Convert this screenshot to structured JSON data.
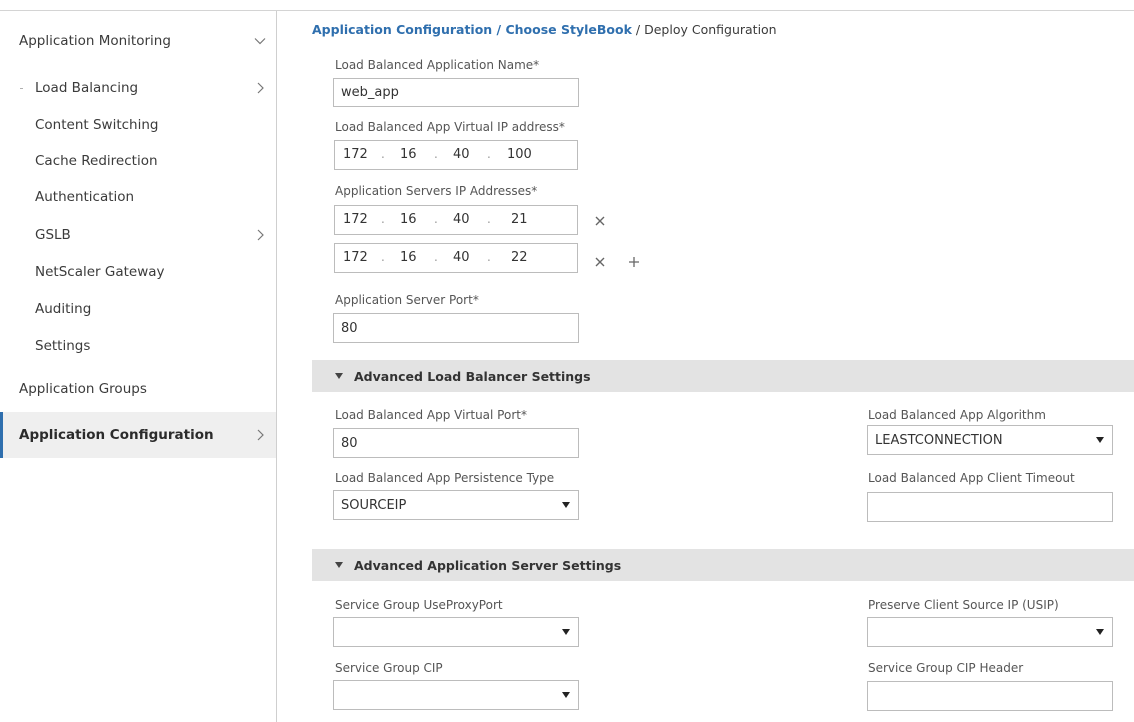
{
  "breadcrumb": {
    "crumb1": "Application Configuration",
    "sep1": " / ",
    "crumb2": "Choose StyleBook",
    "sep2": " / ",
    "current": "Deploy Configuration"
  },
  "sidebar": {
    "application_monitoring": "Application Monitoring",
    "load_balancing": "Load Balancing",
    "content_switching": "Content Switching",
    "cache_redirection": "Cache Redirection",
    "authentication": "Authentication",
    "gslb": "GSLB",
    "netscaler_gateway": "NetScaler Gateway",
    "auditing": "Auditing",
    "settings": "Settings",
    "application_groups": "Application Groups",
    "application_configuration": "Application Configuration"
  },
  "form": {
    "app_name_label": "Load Balanced Application Name*",
    "app_name_value": "web_app",
    "vip_label": "Load Balanced App Virtual IP address*",
    "vip": [
      "172",
      "16",
      "40",
      "100"
    ],
    "servers_label": "Application Servers IP Addresses*",
    "server1": [
      "172",
      "16",
      "40",
      "21"
    ],
    "server2": [
      "172",
      "16",
      "40",
      "22"
    ],
    "port_label": "Application Server Port*",
    "port_value": "80"
  },
  "advanced_lb": {
    "title": "Advanced Load Balancer Settings",
    "vport_label": "Load Balanced App Virtual Port*",
    "vport_value": "80",
    "algorithm_label": "Load Balanced App Algorithm",
    "algorithm_value": "LEASTCONNECTION",
    "persistence_label": "Load Balanced App Persistence Type",
    "persistence_value": "SOURCEIP",
    "timeout_label": "Load Balanced App Client Timeout",
    "timeout_value": ""
  },
  "advanced_server": {
    "title": "Advanced Application Server Settings",
    "useproxyport_label": "Service Group UseProxyPort",
    "useproxyport_value": "",
    "usip_label": "Preserve Client Source IP (USIP)",
    "usip_value": "",
    "cip_label": "Service Group CIP",
    "cip_value": "",
    "cip_header_label": "Service Group CIP Header",
    "cip_header_value": ""
  },
  "icons": {
    "chevron": "chevron-icon",
    "remove": "close-icon",
    "add": "plus-icon",
    "section_toggle": "triangle-down-icon",
    "dropdown": "dropdown-arrow-icon"
  },
  "colors": {
    "link": "#2f6fae",
    "section_bg": "#e3e3e3",
    "active_nav_bg": "#efefef",
    "border": "#bcbcbc"
  }
}
